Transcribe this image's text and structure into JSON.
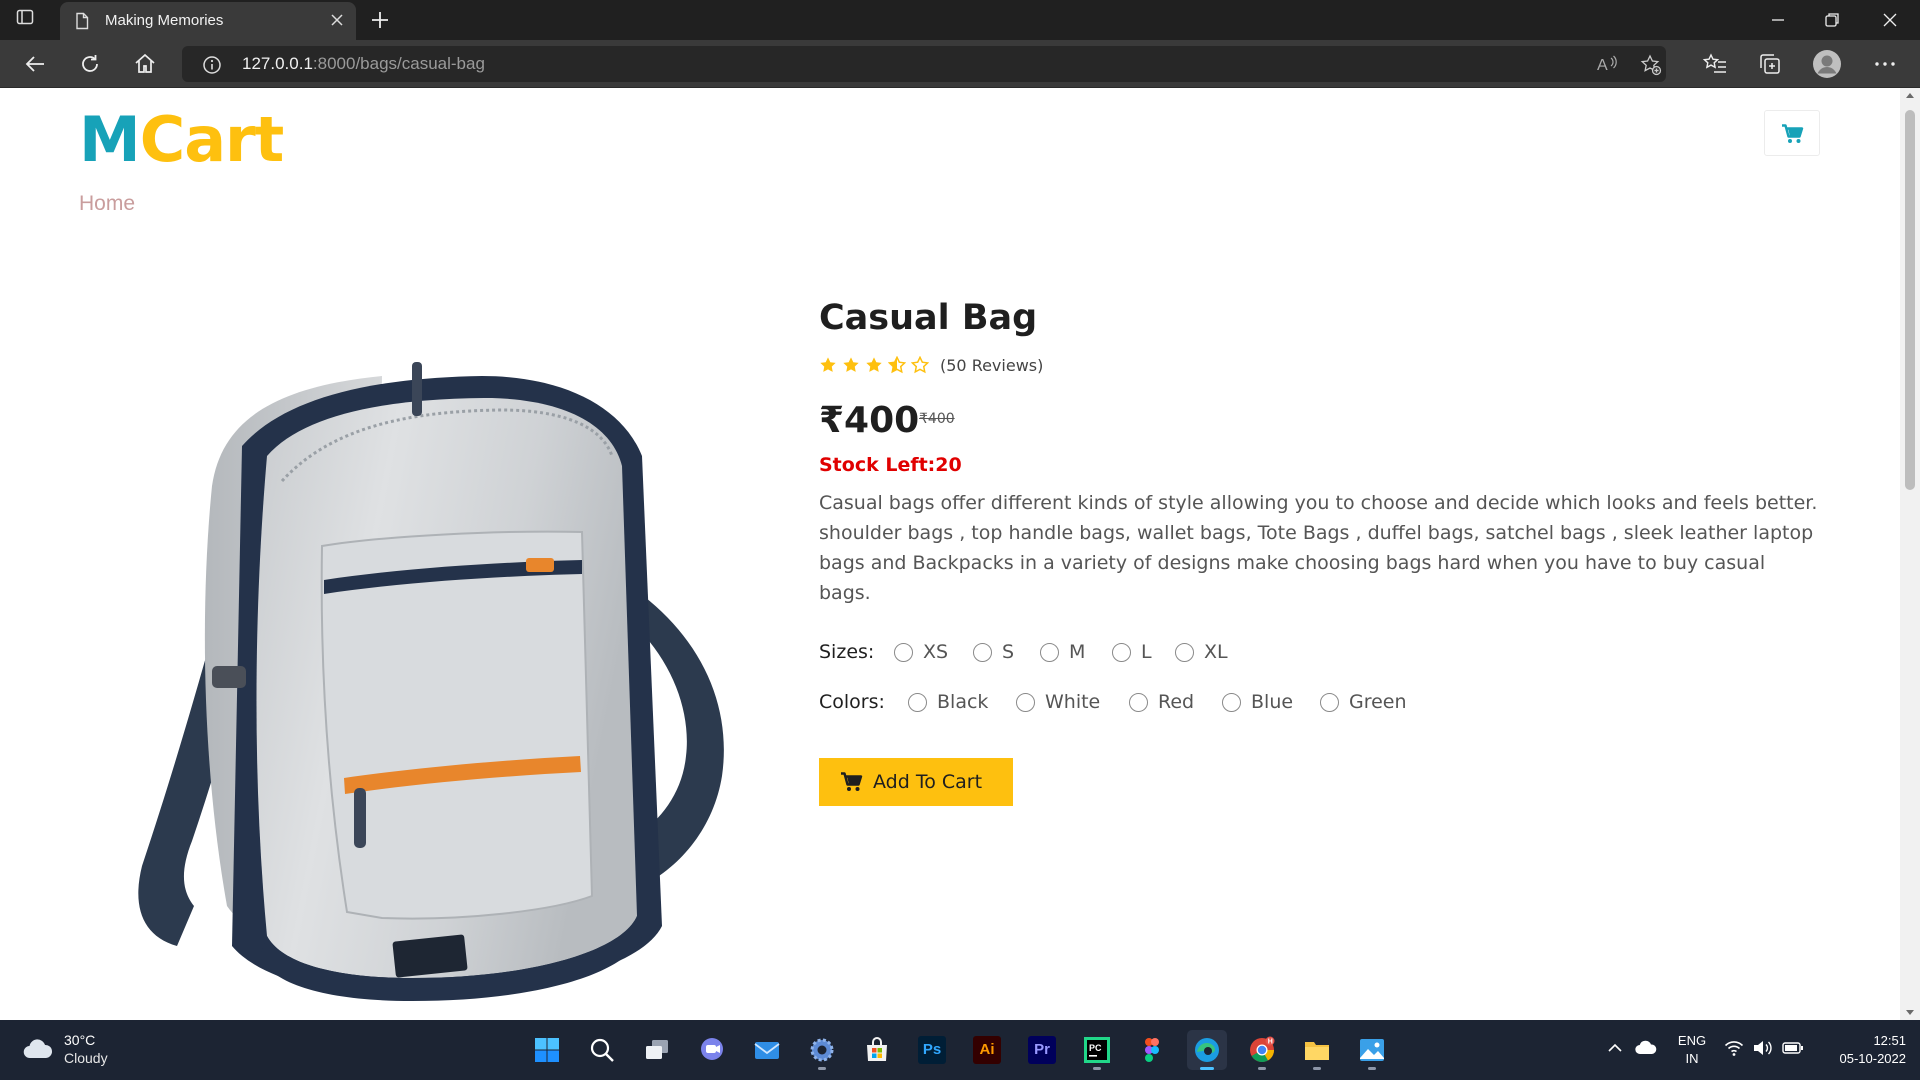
{
  "browser": {
    "tab_title": "Making Memories",
    "url_host": "127.0.0.1",
    "url_path": ":8000/bags/casual-bag"
  },
  "site": {
    "logo_part1": "M",
    "logo_part2": "Cart",
    "breadcrumb_home": "Home",
    "brand_color": "#17a2b8",
    "accent_color": "#fec00f"
  },
  "product": {
    "title": "Casual Bag",
    "rating": 3.5,
    "rating_max": 5,
    "reviews_text": "(50 Reviews)",
    "price": "₹400",
    "old_price": "₹400",
    "stock_text": "Stock Left:20",
    "description": "Casual bags offer different kinds of style allowing you to choose and decide which looks and feels better. shoulder bags , top handle bags, wallet bags, Tote Bags , duffel bags, satchel bags , sleek leather laptop bags and Backpacks in a variety of designs make choosing bags hard when you have to buy casual bags.",
    "sizes_label": "Sizes:",
    "sizes": [
      "XS",
      "S",
      "M",
      "L",
      "XL"
    ],
    "colors_label": "Colors:",
    "colors": [
      "Black",
      "White",
      "Red",
      "Blue",
      "Green"
    ],
    "add_to_cart_label": "Add To Cart"
  },
  "taskbar": {
    "weather_temp": "30°C",
    "weather_condition": "Cloudy",
    "lang_line1": "ENG",
    "lang_line2": "IN",
    "time": "12:51",
    "date": "05-10-2022",
    "apps": [
      "start-icon",
      "search-icon",
      "task-view-icon",
      "chat-icon",
      "mail-icon",
      "settings-icon",
      "store-icon",
      "photoshop-icon",
      "illustrator-icon",
      "premiere-icon",
      "pycharm-icon",
      "figma-icon",
      "edge-icon",
      "chrome-icon",
      "file-explorer-icon",
      "photos-icon"
    ]
  }
}
